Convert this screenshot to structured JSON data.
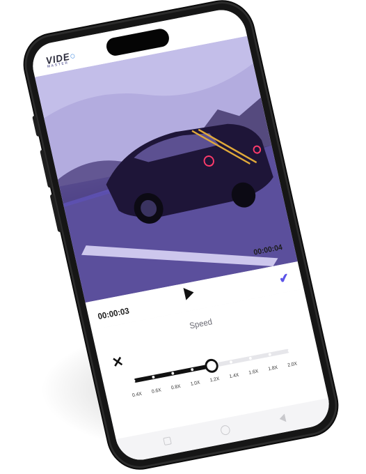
{
  "app": {
    "logo_text": "VIDE",
    "logo_sub": "MASTER"
  },
  "video": {
    "elapsed_time": "00:00:03",
    "total_time": "00:00:04"
  },
  "speed_panel": {
    "title": "Speed",
    "selected_value": "1.0X",
    "selected_fraction": 0.5,
    "ticks": [
      "0.4X",
      "0.6X",
      "0.8X",
      "1.0X",
      "1.2X",
      "1.4X",
      "1.6X",
      "1.8X",
      "2.0X"
    ]
  },
  "colors": {
    "accent": "#5b53e8"
  },
  "icons": {
    "play": "play-icon",
    "confirm": "check-icon",
    "cancel": "close-icon"
  }
}
